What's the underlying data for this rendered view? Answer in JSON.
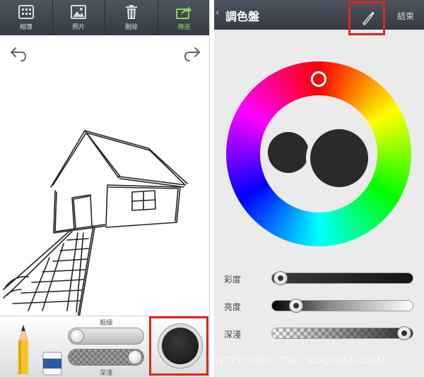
{
  "toolbar": {
    "items": [
      {
        "label": "相簿",
        "icon": "album-grid-icon"
      },
      {
        "label": "照片",
        "icon": "photo-icon"
      },
      {
        "label": "刪除",
        "icon": "trash-icon"
      },
      {
        "label": "傳送",
        "icon": "share-icon"
      }
    ]
  },
  "drawing": {
    "thickness_label": "粗細",
    "depth_label": "深淺",
    "thickness_level": 0.0,
    "depth_level": 1.0,
    "current_color": "#1a1a1a",
    "highlight_color": "#e0261c"
  },
  "palette": {
    "title": "調色盤",
    "done_label": "結束",
    "saturation_label": "彩度",
    "brightness_label": "亮度",
    "opacity_label": "深淺",
    "saturation_level": 0.0,
    "brightness_level": 0.15,
    "opacity_level": 1.0,
    "selected_color": "#2a2a2a"
  },
  "watermark": "HTTP://APK.TW / KOCHIAN.COM"
}
